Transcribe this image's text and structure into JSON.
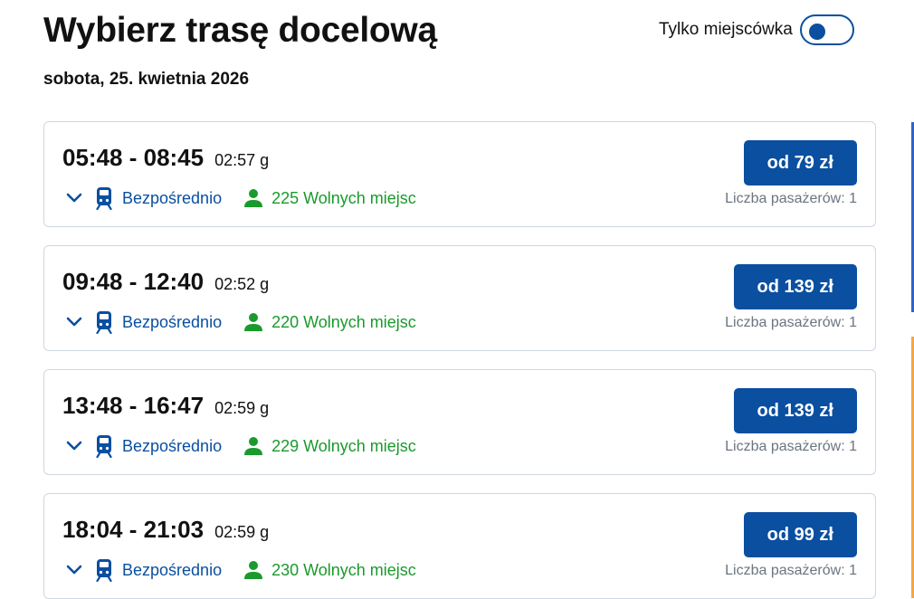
{
  "header": {
    "title": "Wybierz trasę docelową",
    "date": "sobota, 25. kwietnia 2026",
    "toggle": {
      "label": "Tylko miejscówka",
      "checked": false
    }
  },
  "colors": {
    "brand": "#0a4fa0",
    "seats_green": "#1a9a2c",
    "muted": "#6b7480",
    "border": "#cfd7df"
  },
  "icons": [
    "chevron-down-icon",
    "train-icon",
    "person-icon"
  ],
  "connections": [
    {
      "time": "05:48 - 08:45",
      "duration": "02:57 g",
      "route": "Bezpośrednio",
      "seats": "225 Wolnych miejsc",
      "price": "od 79 zł",
      "passengers": "Liczba pasażerów: 1"
    },
    {
      "time": "09:48 - 12:40",
      "duration": "02:52 g",
      "route": "Bezpośrednio",
      "seats": "220 Wolnych miejsc",
      "price": "od 139 zł",
      "passengers": "Liczba pasażerów: 1"
    },
    {
      "time": "13:48 - 16:47",
      "duration": "02:59 g",
      "route": "Bezpośrednio",
      "seats": "229 Wolnych miejsc",
      "price": "od 139 zł",
      "passengers": "Liczba pasażerów: 1"
    },
    {
      "time": "18:04 - 21:03",
      "duration": "02:59 g",
      "route": "Bezpośrednio",
      "seats": "230 Wolnych miejsc",
      "price": "od 99 zł",
      "passengers": "Liczba pasażerów: 1"
    }
  ]
}
